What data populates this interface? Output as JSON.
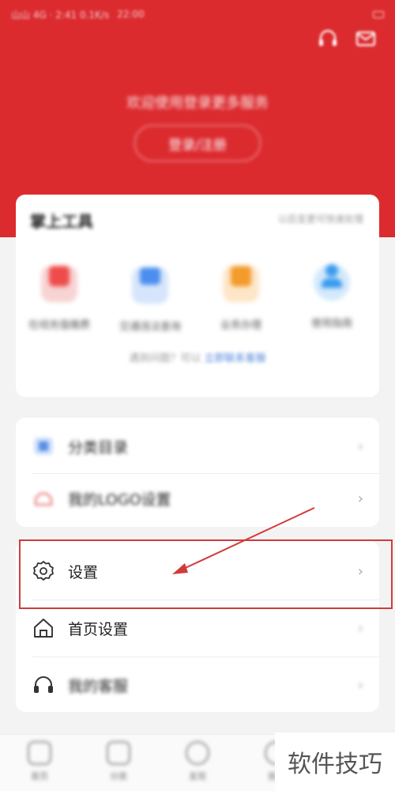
{
  "status_bar": {
    "left_text": "山山 4G · 2:41 0.1K/s",
    "time": "22:00"
  },
  "header": {
    "login_hint": "欢迎使用登录更多服务",
    "login_button": "登录/注册",
    "icons": [
      "headset-icon",
      "mail-icon"
    ],
    "bg_color": "#dc2b2f"
  },
  "tools": {
    "title": "掌上工具",
    "more": "以后变更可快速处理",
    "items": [
      {
        "label": "在线充值缴费",
        "color": "#ef4b4b"
      },
      {
        "label": "交通违法查询",
        "color": "#4b8ef0"
      },
      {
        "label": "业务办理",
        "color": "#f39b2b"
      },
      {
        "label": "使用指南",
        "color": "#3a9bee"
      }
    ],
    "footer": "遇到问题？可以",
    "footer_link": "立即联系客服"
  },
  "list1": [
    {
      "label": "分类目录",
      "icon": "catalog-icon"
    },
    {
      "label": "我的LOGO设置",
      "icon": "cloud-icon"
    }
  ],
  "list2": [
    {
      "label": "设置",
      "icon": "gear-icon"
    },
    {
      "label": "首页设置",
      "icon": "home-icon"
    },
    {
      "label": "我的客服",
      "icon": "headset-icon"
    }
  ],
  "bottom_nav": [
    "首页",
    "分类",
    "发现",
    "我的"
  ],
  "watermark": "软件技巧",
  "colors": {
    "highlight": "#d23a3a",
    "accent": "#dc2b2f"
  }
}
